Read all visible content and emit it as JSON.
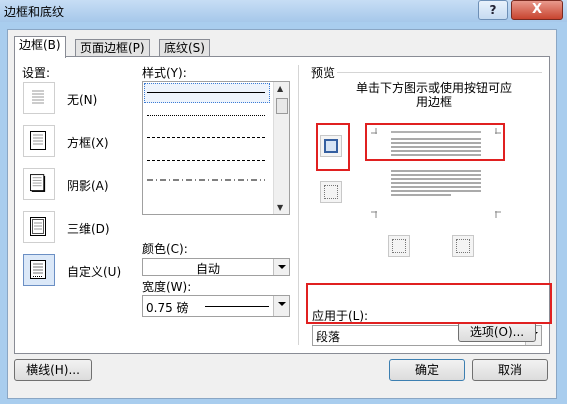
{
  "window": {
    "title": "边框和底纹",
    "help_label": "?",
    "close_label": "X"
  },
  "tabs": [
    {
      "label": "边框(B)",
      "active": true
    },
    {
      "label": "页面边框(P)",
      "active": false
    },
    {
      "label": "底纹(S)",
      "active": false
    }
  ],
  "settings": {
    "heading": "设置:",
    "options": [
      {
        "label": "无(N)",
        "icon": "none-border-icon"
      },
      {
        "label": "方框(X)",
        "icon": "box-border-icon"
      },
      {
        "label": "阴影(A)",
        "icon": "shadow-border-icon"
      },
      {
        "label": "三维(D)",
        "icon": "3d-border-icon"
      },
      {
        "label": "自定义(U)",
        "icon": "custom-border-icon",
        "selected": true
      }
    ]
  },
  "style": {
    "label": "样式(Y):",
    "color_label": "颜色(C):",
    "color_value": "自动",
    "width_label": "宽度(W):",
    "width_value": "0.75 磅"
  },
  "preview": {
    "heading": "预览",
    "hint": "单击下方图示或使用按钮可应用边框",
    "apply_label": "应用于(L):",
    "apply_value": "段落",
    "options_button": "选项(O)..."
  },
  "footer": {
    "horizontal_line_button": "横线(H)...",
    "ok_button": "确定",
    "cancel_button": "取消"
  },
  "colors": {
    "accent": "#e02020",
    "titlebar": "#a9cdee",
    "close": "#c8442f"
  }
}
